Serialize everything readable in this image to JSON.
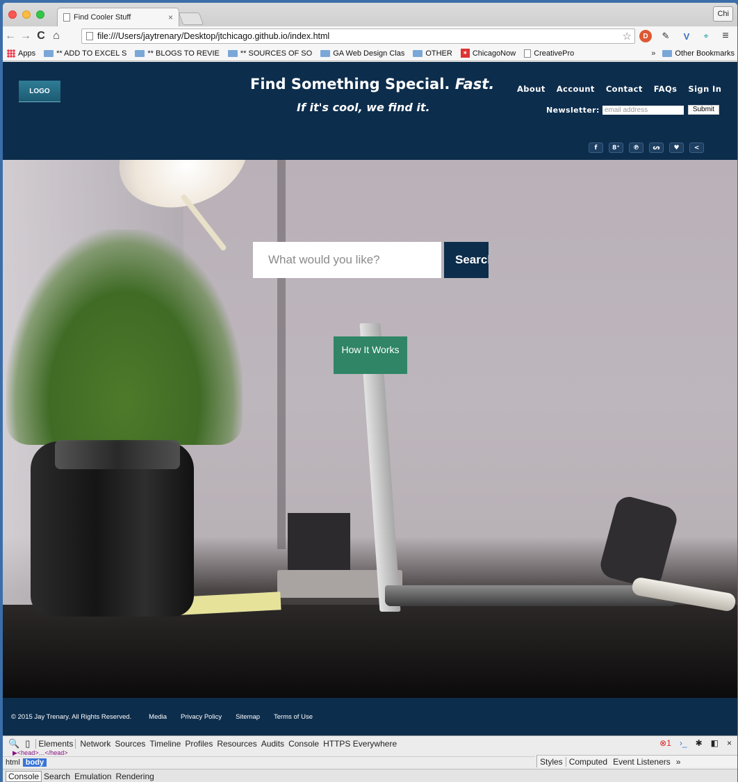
{
  "browser": {
    "tab_title": "Find Cooler Stuff",
    "tab_close": "×",
    "profile_label": "Chi",
    "url": "file:///Users/jaytrenary/Desktop/jtchicago.github.io/index.html",
    "bookmarks": [
      {
        "label": "Apps",
        "icon": "apps-icon"
      },
      {
        "label": "** ADD TO EXCEL S",
        "icon": "folder-icon"
      },
      {
        "label": "** BLOGS TO REVIE",
        "icon": "folder-icon"
      },
      {
        "label": "** SOURCES OF SO",
        "icon": "folder-icon"
      },
      {
        "label": "GA Web Design Clas",
        "icon": "folder-icon"
      },
      {
        "label": "OTHER",
        "icon": "folder-icon"
      },
      {
        "label": "ChicagoNow",
        "icon": "chicagonow-icon"
      },
      {
        "label": "CreativePro",
        "icon": "page-icon"
      }
    ],
    "overflow": "»",
    "other_bookmarks": "Other Bookmarks"
  },
  "site": {
    "logo": "LOGO",
    "headline": "Find Something Special.",
    "headline_emphasis": "Fast.",
    "tagline": "If it's cool, we find it.",
    "nav": [
      "About",
      "Account",
      "Contact",
      "FAQs",
      "Sign In"
    ],
    "newsletter_label": "Newsletter:",
    "newsletter_placeholder": "email address",
    "newsletter_submit": "Submit",
    "social": [
      {
        "name": "facebook-icon",
        "glyph": "f"
      },
      {
        "name": "google-plus-icon",
        "glyph": "8⁺"
      },
      {
        "name": "pinterest-icon",
        "glyph": "℗"
      },
      {
        "name": "stumbleupon-icon",
        "glyph": "ᔕ"
      },
      {
        "name": "twitter-icon",
        "glyph": "♥"
      },
      {
        "name": "share-icon",
        "glyph": "<"
      }
    ],
    "search_placeholder": "What would you like?",
    "search_button": "Search",
    "how_it_works": "How It Works",
    "footer": {
      "copyright": "© 2015 Jay Trenary. All Rights Reserved.",
      "links": [
        "Media",
        "Privacy Policy",
        "Sitemap",
        "Terms of Use"
      ]
    }
  },
  "devtools": {
    "tabs": [
      "Elements",
      "Network",
      "Sources",
      "Timeline",
      "Profiles",
      "Resources",
      "Audits",
      "Console",
      "HTTPS Everywhere"
    ],
    "error_count": "1",
    "dom_line": "▶<head>…</head>",
    "crumbs": [
      "html",
      "body"
    ],
    "side_tabs": [
      "Styles",
      "Computed",
      "Event Listeners"
    ],
    "side_more": "»",
    "drawer_tabs": [
      "Console",
      "Search",
      "Emulation",
      "Rendering"
    ]
  },
  "colors": {
    "header_bg": "#0d2d4c",
    "how_button": "#2f8566"
  }
}
